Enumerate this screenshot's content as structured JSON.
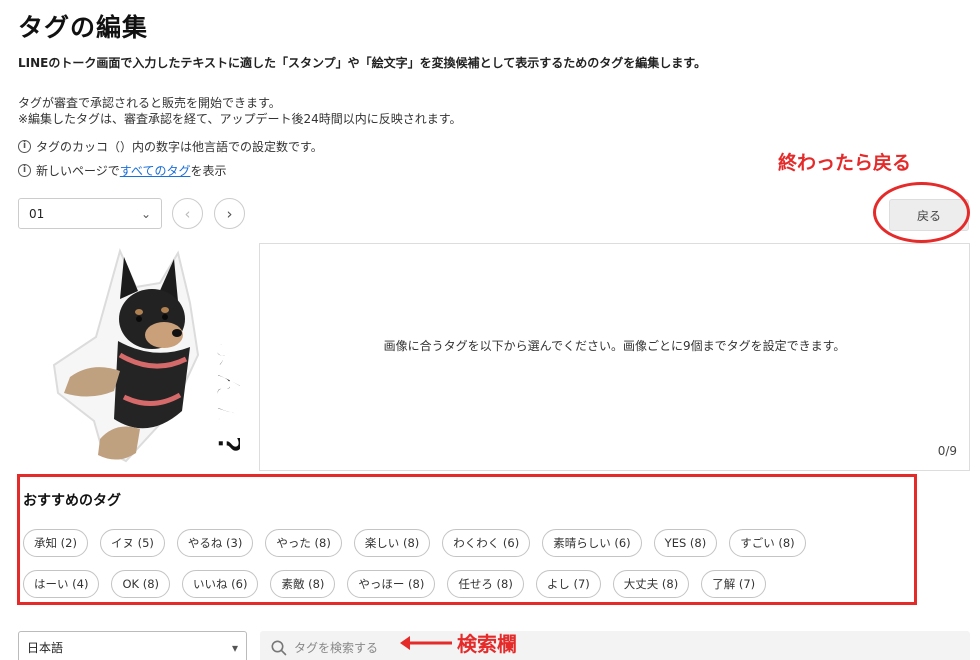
{
  "page": {
    "title": "タグの編集",
    "description": "LINEのトーク画面で入力したテキストに適した「スタンプ」や「絵文字」を変換候補として表示するためのタグを編集します。",
    "note1": "タグが審査で承認されると販売を開始できます。",
    "note2": "※編集したタグは、審査承認を経て、アップデート後24時間以内に反映されます。",
    "info1": "タグのカッコ（）内の数字は他言語での設定数です。",
    "info2_prefix": "新しいページで",
    "info2_link": "すべてのタグ",
    "info2_suffix": "を表示"
  },
  "annotations": {
    "back_hint": "終わったら戻る",
    "search_hint": "検索欄"
  },
  "controls": {
    "sticker_select_value": "01",
    "back_label": "戻る",
    "language_select_value": "日本語",
    "search_placeholder": "タグを検索する"
  },
  "sticker": {
    "caption": "よんだ?"
  },
  "tag_area": {
    "message": "画像に合うタグを以下から選んでください。画像ごとに9個までタグを設定できます。",
    "count": "0/9"
  },
  "recommended": {
    "title": "おすすめのタグ",
    "row1": [
      "承知 (2)",
      "イヌ (5)",
      "やるね (3)",
      "やった (8)",
      "楽しい (8)",
      "わくわく (6)",
      "素晴らしい (6)",
      "YES (8)",
      "すごい (8)"
    ],
    "row2": [
      "はーい (4)",
      "OK (8)",
      "いいね (6)",
      "素敵 (8)",
      "やっほー (8)",
      "任せろ (8)",
      "よし (7)",
      "大丈夫 (8)",
      "了解 (7)"
    ]
  },
  "colors": {
    "annotation_red": "#e52a2a",
    "link_blue": "#1a6fd8"
  },
  "icons": {
    "info": "info-icon",
    "chevron_down": "chevron-down-icon",
    "chevron_left": "chevron-left-icon",
    "chevron_right": "chevron-right-icon",
    "search": "search-icon",
    "arrow_left": "arrow-left-icon"
  }
}
